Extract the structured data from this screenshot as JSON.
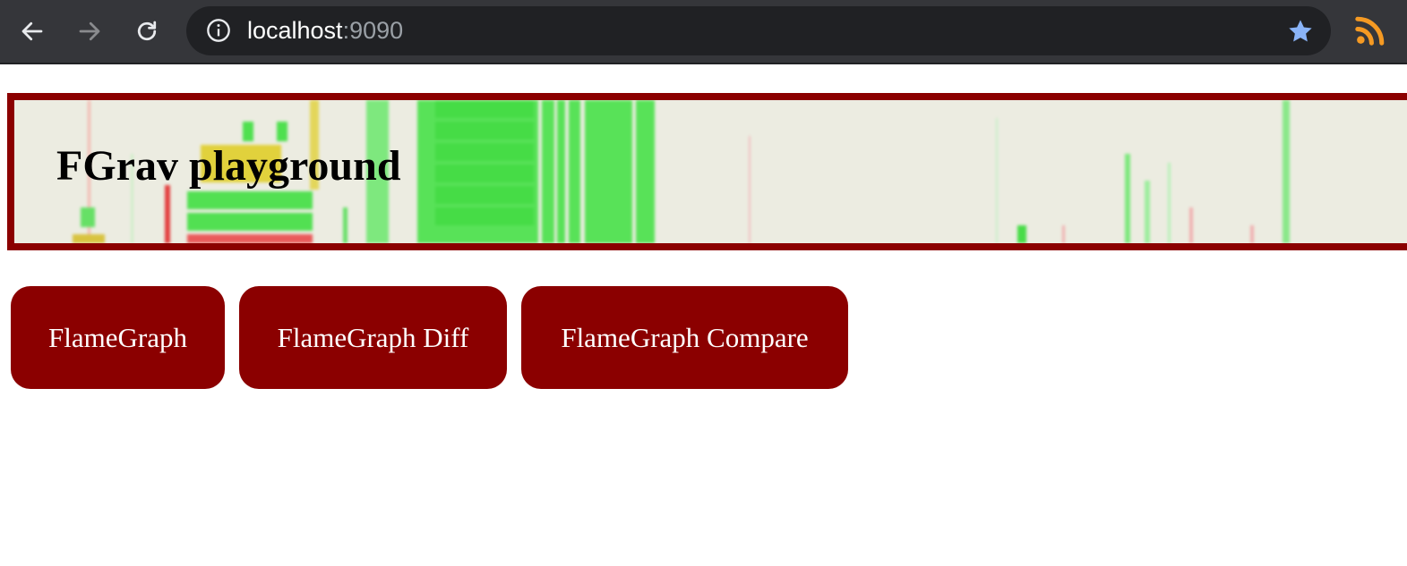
{
  "browser": {
    "url_host": "localhost",
    "url_port": ":9090",
    "icons": [
      "back-arrow-icon",
      "forward-arrow-icon",
      "reload-icon",
      "info-icon",
      "star-icon",
      "rss-icon"
    ],
    "colors": {
      "star": "#8ab4f8",
      "rss": "#f59a23"
    }
  },
  "banner": {
    "title": "FGrav playground",
    "frame_color": "#8b0000"
  },
  "buttons": [
    {
      "label": "FlameGraph"
    },
    {
      "label": "FlameGraph Diff"
    },
    {
      "label": "FlameGraph Compare"
    }
  ],
  "colors": {
    "button_bg": "#8b0000",
    "button_text": "#ffffff"
  }
}
